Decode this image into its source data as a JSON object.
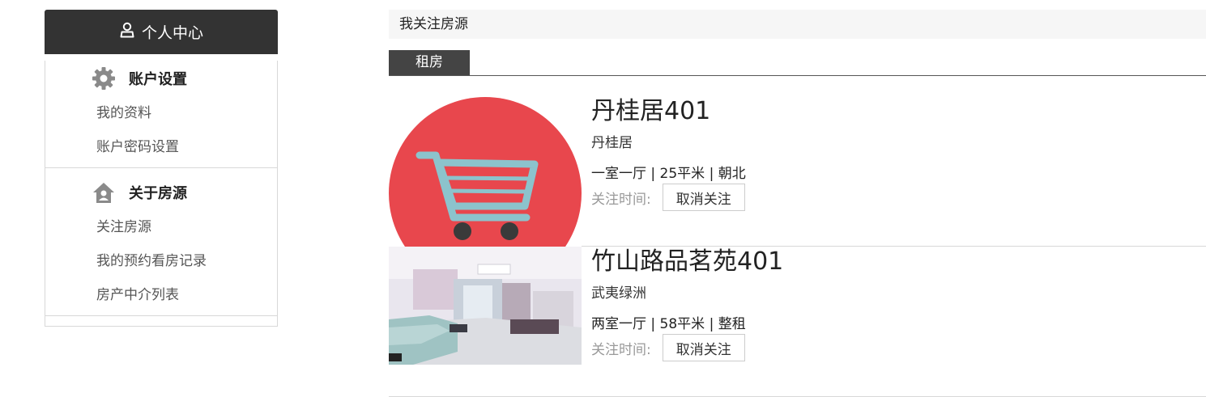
{
  "sidebar": {
    "header_title": "个人中心",
    "sections": [
      {
        "title": "账户设置",
        "icon": "gear-icon",
        "items": [
          "我的资料",
          "账户密码设置"
        ]
      },
      {
        "title": "关于房源",
        "icon": "house-icon",
        "items": [
          "关注房源",
          "我的预约看房记录",
          "房产中介列表"
        ]
      }
    ]
  },
  "main": {
    "breadcrumb": "我关注房源",
    "tabs": [
      {
        "label": "租房",
        "active": true
      }
    ],
    "listings": [
      {
        "title": "丹桂居401",
        "community": "丹桂居",
        "specs": "一室一厅 | 25平米 | 朝北",
        "follow_time_label": "关注时间:",
        "unfollow_label": "取消关注",
        "image": "shopping-cart-placeholder"
      },
      {
        "title": "竹山路品茗苑401",
        "community": "武夷绿洲",
        "specs": "两室一厅 | 58平米 | 整租",
        "follow_time_label": "关注时间:",
        "unfollow_label": "取消关注",
        "image": "living-room-photo"
      }
    ]
  },
  "colors": {
    "header_bg": "#333333",
    "tab_bg": "#444444",
    "cart_circle": "#e8474d",
    "cart_body": "#8cc3cc"
  }
}
